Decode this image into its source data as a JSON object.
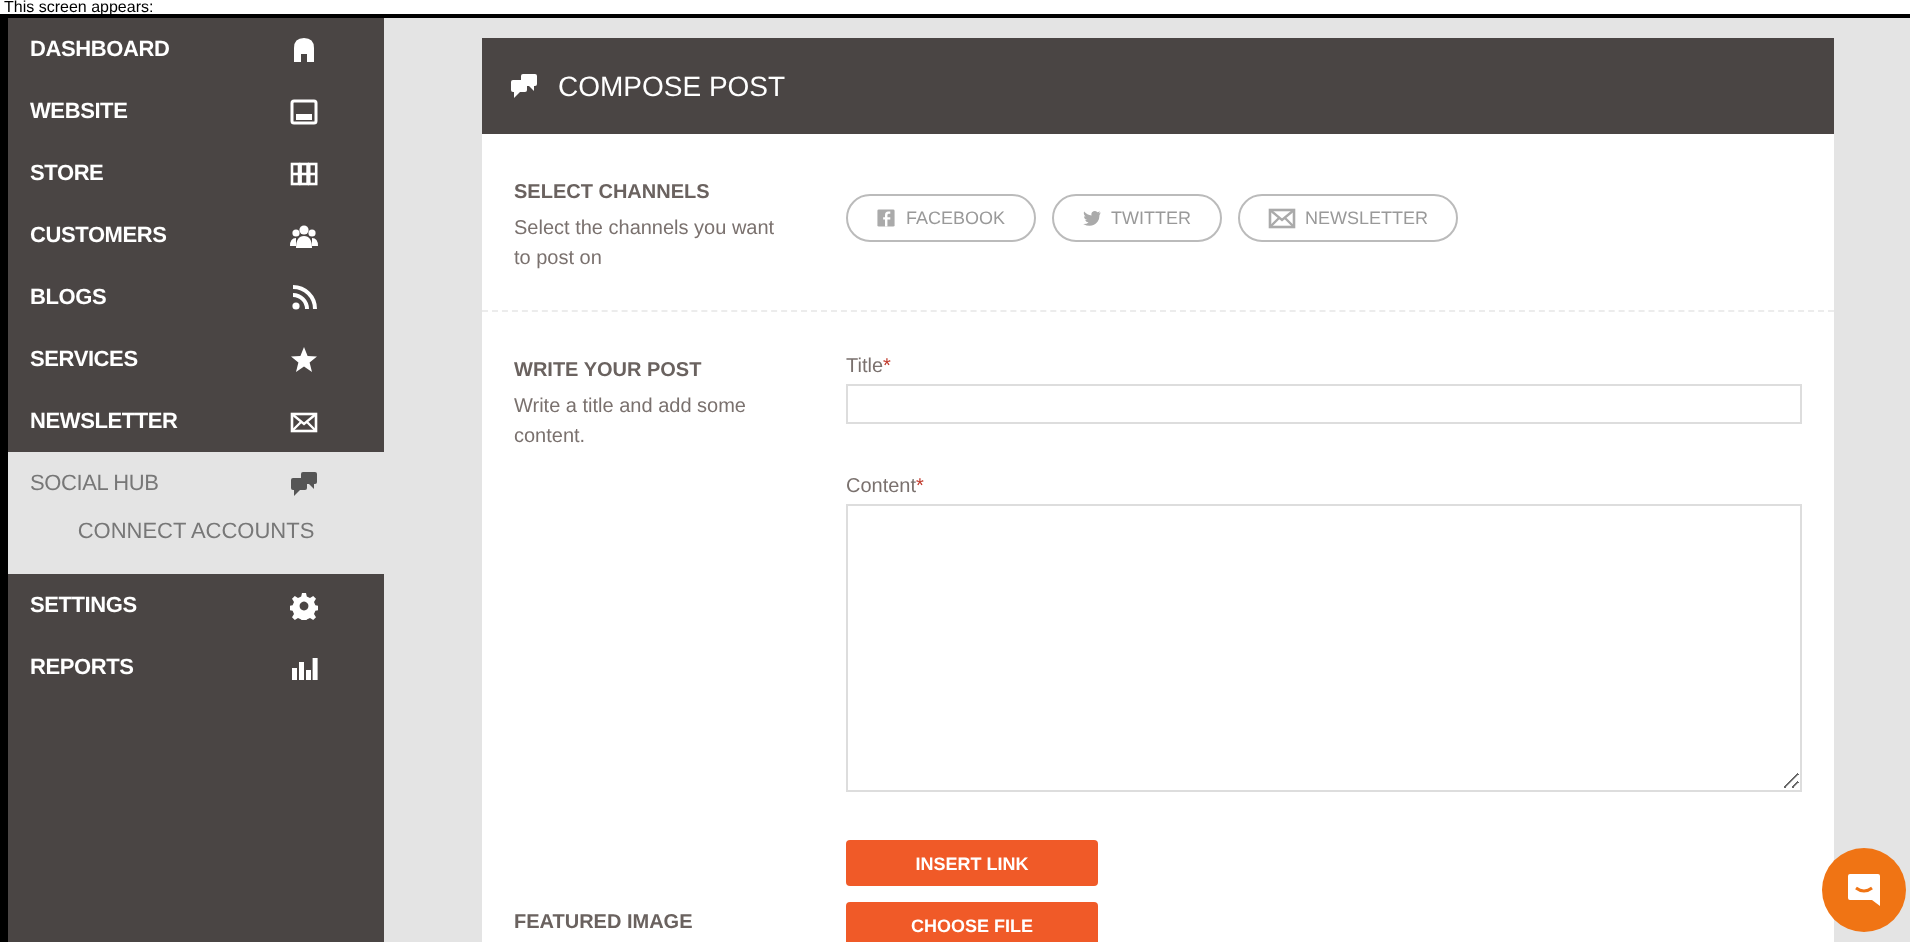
{
  "caption": "This screen appears:",
  "sidebar": {
    "items": [
      {
        "label": "DASHBOARD",
        "kind": "home",
        "selected": false
      },
      {
        "label": "WEBSITE",
        "kind": "window",
        "selected": false
      },
      {
        "label": "STORE",
        "kind": "grid",
        "selected": false
      },
      {
        "label": "CUSTOMERS",
        "kind": "people",
        "selected": false
      },
      {
        "label": "BLOGS",
        "kind": "rss",
        "selected": false
      },
      {
        "label": "SERVICES",
        "kind": "star",
        "selected": false
      },
      {
        "label": "NEWSLETTER",
        "kind": "mail",
        "selected": false
      },
      {
        "label": "SOCIAL HUB",
        "kind": "chat",
        "selected": true,
        "children": [
          {
            "label": "CONNECT ACCOUNTS"
          }
        ]
      },
      {
        "label": "SETTINGS",
        "kind": "gear",
        "selected": false
      },
      {
        "label": "REPORTS",
        "kind": "bars",
        "selected": false
      }
    ]
  },
  "card": {
    "title": "COMPOSE POST",
    "sections": [
      {
        "kind": "channels",
        "heading": "SELECT CHANNELS",
        "description": "Select the channels you want to post on",
        "channels": [
          {
            "label": "FACEBOOK",
            "kind": "facebook",
            "selected": false
          },
          {
            "label": "TWITTER",
            "kind": "bird",
            "selected": false
          },
          {
            "label": "NEWSLETTER",
            "kind": "mail",
            "selected": false
          }
        ]
      },
      {
        "kind": "post",
        "heading": "WRITE YOUR POST",
        "description": "Write a title and add some content.",
        "title_label": "Title",
        "content_label": "Content",
        "required_mark": "*",
        "button": "INSERT LINK"
      },
      {
        "kind": "image",
        "heading": "FEATURED IMAGE",
        "button": "CHOOSE FILE"
      }
    ]
  }
}
